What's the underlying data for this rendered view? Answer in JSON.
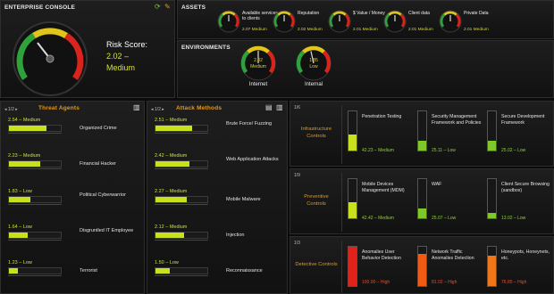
{
  "console": {
    "title": "ENTERPRISE CONSOLE",
    "risk_label": "Risk Score:",
    "risk_value": "2.02 –",
    "risk_level": "Medium"
  },
  "assets": {
    "title": "ASSETS",
    "items": [
      {
        "label": "Available services to clients",
        "value": "2.07 Medium"
      },
      {
        "label": "Reputation",
        "value": "2.02 Medium"
      },
      {
        "label": "$ Value / Money",
        "value": "2.01 Medium"
      },
      {
        "label": "Client data",
        "value": "2.01 Medium"
      },
      {
        "label": "Private Data",
        "value": "2.01 Medium"
      }
    ]
  },
  "environments": {
    "title": "ENVIRONMENTS",
    "items": [
      {
        "name": "Internet",
        "value": "2.02",
        "level": "Medium"
      },
      {
        "name": "Internal",
        "value": "1.85",
        "level": "Low"
      }
    ]
  },
  "threat_agents": {
    "title": "Threat Agents",
    "pager": "1/2",
    "items": [
      {
        "value": "2.54 – Medium",
        "label": "Organized Crime",
        "fill": 0.72
      },
      {
        "value": "2.23 – Medium",
        "label": "Financial Hacker",
        "fill": 0.6
      },
      {
        "value": "1.83 – Low",
        "label": "Political Cyberwarrior",
        "fill": 0.42
      },
      {
        "value": "1.64 – Low",
        "label": "Disgruntled IT Employee",
        "fill": 0.36
      },
      {
        "value": "1.23 – Low",
        "label": "Terrorist",
        "fill": 0.18
      }
    ]
  },
  "attack_methods": {
    "title": "Attack Methods",
    "pager": "1/2",
    "items": [
      {
        "value": "2.51 – Medium",
        "label": "Brute Force/ Fuzzing",
        "fill": 0.7
      },
      {
        "value": "2.42 – Medium",
        "label": "Web Application Attacks",
        "fill": 0.66
      },
      {
        "value": "2.27 – Medium",
        "label": "Mobile Malware",
        "fill": 0.6
      },
      {
        "value": "2.12 – Medium",
        "label": "Injection",
        "fill": 0.55
      },
      {
        "value": "1.50 – Low",
        "label": "Reconnaissance",
        "fill": 0.28
      }
    ]
  },
  "controls": [
    {
      "title": "Infrastructure Controls",
      "pager": "1/6",
      "items": [
        {
          "label": "Penetration Testing",
          "value": "42.23 – Medium",
          "fill": 0.42,
          "color": "#c8e01e",
          "high": false
        },
        {
          "label": "Security Management Framework and Policies",
          "value": "25.11 – Low",
          "fill": 0.25,
          "color": "#7ec82a",
          "high": false
        },
        {
          "label": "Secure Development Framework",
          "value": "25.02 – Low",
          "fill": 0.25,
          "color": "#7ec82a",
          "high": false
        }
      ]
    },
    {
      "title": "Preventive Controls",
      "pager": "1/9",
      "items": [
        {
          "label": "Mobile Devices Management (MDM)",
          "value": "42.42 – Medium",
          "fill": 0.42,
          "color": "#c8e01e",
          "high": false
        },
        {
          "label": "WAF",
          "value": "25.07 – Low",
          "fill": 0.25,
          "color": "#7ec82a",
          "high": false
        },
        {
          "label": "Client Secure Browsing (sandbox)",
          "value": "13.02 – Low",
          "fill": 0.13,
          "color": "#7ec82a",
          "high": false
        }
      ]
    },
    {
      "title": "Detective Controls",
      "pager": "1/3",
      "items": [
        {
          "label": "Anomalies User Behavior Detection",
          "value": "100.00 – High",
          "fill": 1.0,
          "color": "#e0221b",
          "high": true
        },
        {
          "label": "Network Traffic Anomalies Detection",
          "value": "81.02 – High",
          "fill": 0.81,
          "color": "#ef5b12",
          "high": true
        },
        {
          "label": "Honeypots, Honeynets, etc.",
          "value": "76.85 – High",
          "fill": 0.77,
          "color": "#f0761a",
          "high": true
        }
      ]
    }
  ],
  "colors": {
    "accent": "#e39a1c",
    "medium": "#c8e01e",
    "low": "#7ec82a",
    "high": "#e0221b"
  }
}
